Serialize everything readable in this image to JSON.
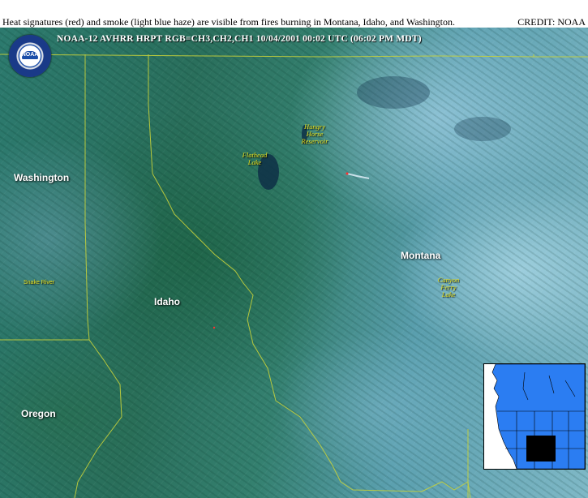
{
  "caption": {
    "text": "Heat signatures (red) and smoke (light blue haze) are visible from fires burning in Montana, Idaho, and Washington.",
    "credit": "CREDIT: NOAA"
  },
  "image_header": "NOAA-12 AVHRR HRPT  RGB=CH3,CH2,CH1  10/04/2001  00:02 UTC  (06:02 PM MDT)",
  "logo": {
    "text": "NOAA"
  },
  "states": {
    "washington": "Washington",
    "idaho": "Idaho",
    "montana": "Montana",
    "oregon": "Oregon"
  },
  "features": {
    "hungry_horse": [
      "Hungry",
      "Horse",
      "Reservoir"
    ],
    "flathead": [
      "Flathead",
      "Lake"
    ],
    "canyon_ferry": [
      "Canyon",
      "Ferry",
      "Lake"
    ],
    "snake_river": "Snake River"
  },
  "colors": {
    "border": "#c8d23a",
    "feature_label": "#e6e020",
    "state_label": "#ffffff",
    "inset_land": "#2b7df2",
    "inset_water": "#ffffff",
    "inset_highlight": "#000000"
  }
}
